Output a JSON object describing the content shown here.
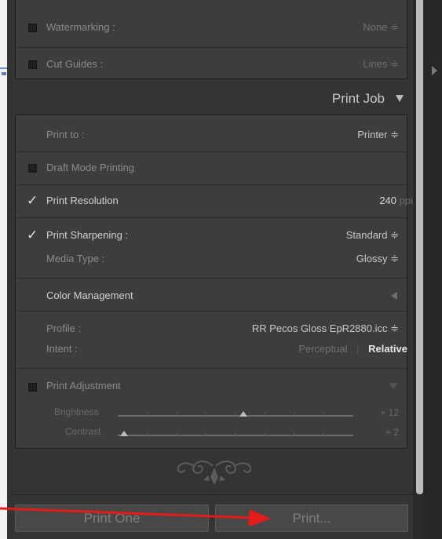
{
  "top_section": {
    "watermarking": {
      "label": "Watermarking :",
      "value": "None ≑"
    },
    "cut_guides": {
      "label": "Cut Guides :",
      "value": "Lines ≑"
    }
  },
  "print_job": {
    "title": "Print Job",
    "print_to": {
      "label": "Print to :",
      "value": "Printer ≑"
    },
    "draft_mode": {
      "label": "Draft Mode Printing"
    },
    "print_resolution": {
      "label": "Print Resolution",
      "value": "240",
      "unit": "ppi"
    },
    "print_sharpening": {
      "label": "Print Sharpening :",
      "value": "Standard ≑"
    },
    "media_type": {
      "label": "Media Type :",
      "value": "Glossy ≑"
    },
    "color_management": {
      "title": "Color Management",
      "profile_label": "Profile :",
      "profile_value": "RR Pecos Gloss EpR2880.icc ≑",
      "intent_label": "Intent :",
      "intent_perceptual": "Perceptual",
      "intent_separator": "|",
      "intent_relative": "Relative"
    },
    "print_adjustment": {
      "label": "Print Adjustment",
      "brightness_label": "Brightness",
      "brightness_value": "+ 12",
      "brightness_level": 12,
      "contrast_label": "Contrast",
      "contrast_value": "+ 2",
      "contrast_level": 2
    }
  },
  "buttons": {
    "print_one": "Print One",
    "print": "Print..."
  }
}
